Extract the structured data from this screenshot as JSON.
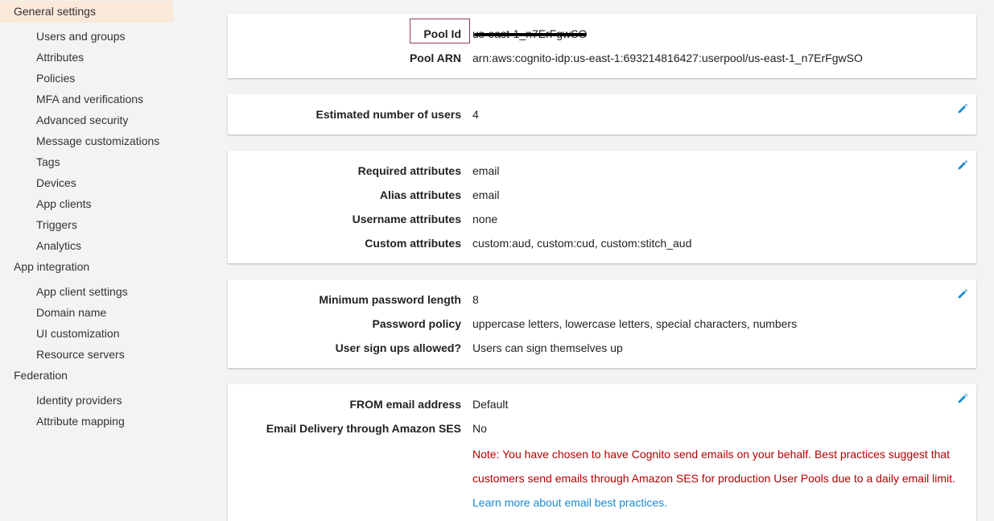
{
  "sidebar": {
    "general_settings": "General settings",
    "general_items": [
      "Users and groups",
      "Attributes",
      "Policies",
      "MFA and verifications",
      "Advanced security",
      "Message customizations",
      "Tags",
      "Devices",
      "App clients",
      "Triggers",
      "Analytics"
    ],
    "app_integration": "App integration",
    "app_items": [
      "App client settings",
      "Domain name",
      "UI customization",
      "Resource servers"
    ],
    "federation": "Federation",
    "federation_items": [
      "Identity providers",
      "Attribute mapping"
    ]
  },
  "pool": {
    "id_label": "Pool Id",
    "id_value": "us-east-1_n7ErFgwSO",
    "arn_label": "Pool ARN",
    "arn_value": "arn:aws:cognito-idp:us-east-1:693214816427:userpool/us-east-1_n7ErFgwSO"
  },
  "users": {
    "estimated_label": "Estimated number of users",
    "estimated_value": "4"
  },
  "attributes": {
    "required_label": "Required attributes",
    "required_value": "email",
    "alias_label": "Alias attributes",
    "alias_value": "email",
    "username_label": "Username attributes",
    "username_value": "none",
    "custom_label": "Custom attributes",
    "custom_value": "custom:aud, custom:cud, custom:stitch_aud"
  },
  "password": {
    "min_length_label": "Minimum password length",
    "min_length_value": "8",
    "policy_label": "Password policy",
    "policy_value": "uppercase letters, lowercase letters, special characters, numbers",
    "signup_label": "User sign ups allowed?",
    "signup_value": "Users can sign themselves up"
  },
  "email": {
    "from_label": "FROM email address",
    "from_value": "Default",
    "ses_label": "Email Delivery through Amazon SES",
    "ses_value": "No",
    "note_line1": "Note: You have chosen to have Cognito send emails on your behalf. Best practices suggest that",
    "note_line2": "customers send emails through Amazon SES for production User Pools due to a daily email limit.",
    "learn_more": "Learn more about email best practices."
  },
  "colors": {
    "active_nav_bg": "#fae8d9",
    "edit_icon": "#1a8ad4",
    "warning_text": "#b30000",
    "link": "#1a8ad4"
  },
  "icons": {
    "edit": "pencil-icon"
  }
}
